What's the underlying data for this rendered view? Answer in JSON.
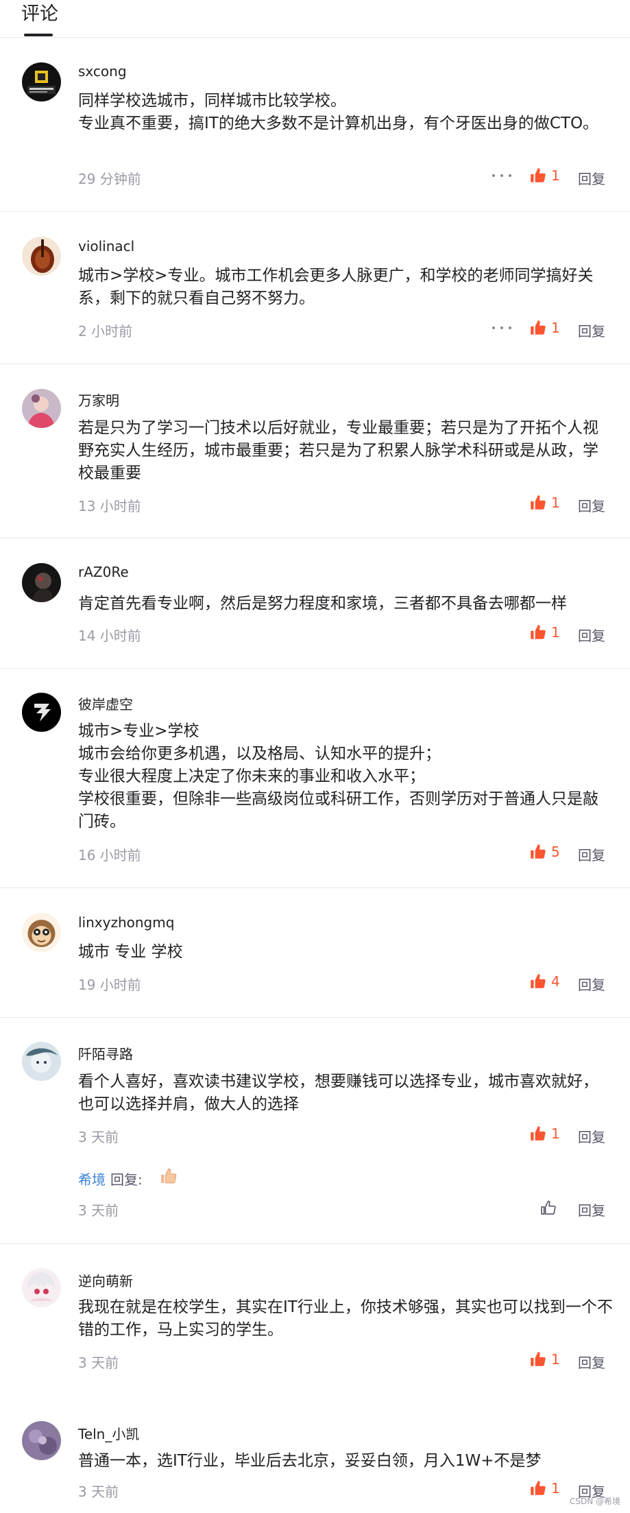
{
  "header": {
    "tab_label": "评论"
  },
  "comments": [
    {
      "username": "sxcong",
      "text": "同样学校选城市，同样城市比较学校。\n专业真不重要，搞IT的绝大多数不是计算机出身，有个牙医出身的做CTO。",
      "time": "29 分钟前",
      "likes": "1",
      "reply": "回复"
    },
    {
      "username": "violinacl",
      "text": "城市>学校>专业。城市工作机会更多人脉更广，和学校的老师同学搞好关系，剩下的就只看自己努不努力。",
      "time": "2 小时前",
      "likes": "1",
      "reply": "回复"
    },
    {
      "username": "万家明",
      "text": "若是只为了学习一门技术以后好就业，专业最重要；若只是为了开拓个人视野充实人生经历，城市最重要；若只是为了积累人脉学术科研或是从政，学校最重要",
      "time": "13 小时前",
      "likes": "1",
      "reply": "回复"
    },
    {
      "username": "rAZ0Re",
      "text": "肯定首先看专业啊，然后是努力程度和家境，三者都不具备去哪都一样",
      "time": "14 小时前",
      "likes": "1",
      "reply": "回复"
    },
    {
      "username": "彼岸虚空",
      "text": "城市>专业>学校\n城市会给你更多机遇，以及格局、认知水平的提升；\n专业很大程度上决定了你未来的事业和收入水平；\n学校很重要，但除非一些高级岗位或科研工作，否则学历对于普通人只是敲门砖。",
      "time": "16 小时前",
      "likes": "5",
      "reply": "回复"
    },
    {
      "username": "linxyzhongmq",
      "text": "城市 专业 学校",
      "time": "19 小时前",
      "likes": "4",
      "reply": "回复"
    },
    {
      "username": "阡陌寻路",
      "text": "看个人喜好，喜欢读书建议学校，想要赚钱可以选择专业，城市喜欢就好，也可以选择并肩，做大人的选择",
      "time": "3 天前",
      "likes": "1",
      "reply": "回复",
      "sub_reply": {
        "username": "希境",
        "label": "回复:",
        "time": "3 天前",
        "reply": "回复"
      }
    },
    {
      "username": "逆向萌新",
      "text": "我现在就是在校学生，其实在IT行业上，你技术够强，其实也可以找到一个不错的工作，马上实习的学生。",
      "time": "3 天前",
      "likes": "1",
      "reply": "回复"
    },
    {
      "username": "Teln_小凯",
      "text": "普通一本，选IT行业，毕业后去北京，妥妥白领，月入1W+不是梦",
      "time": "3 天前",
      "likes": "1",
      "reply": "回复"
    }
  ],
  "footer": {
    "watermark": "CSDN @希境"
  },
  "colors": {
    "accent": "#fc5531",
    "link": "#3d85d6",
    "muted": "#9a9aa6"
  }
}
